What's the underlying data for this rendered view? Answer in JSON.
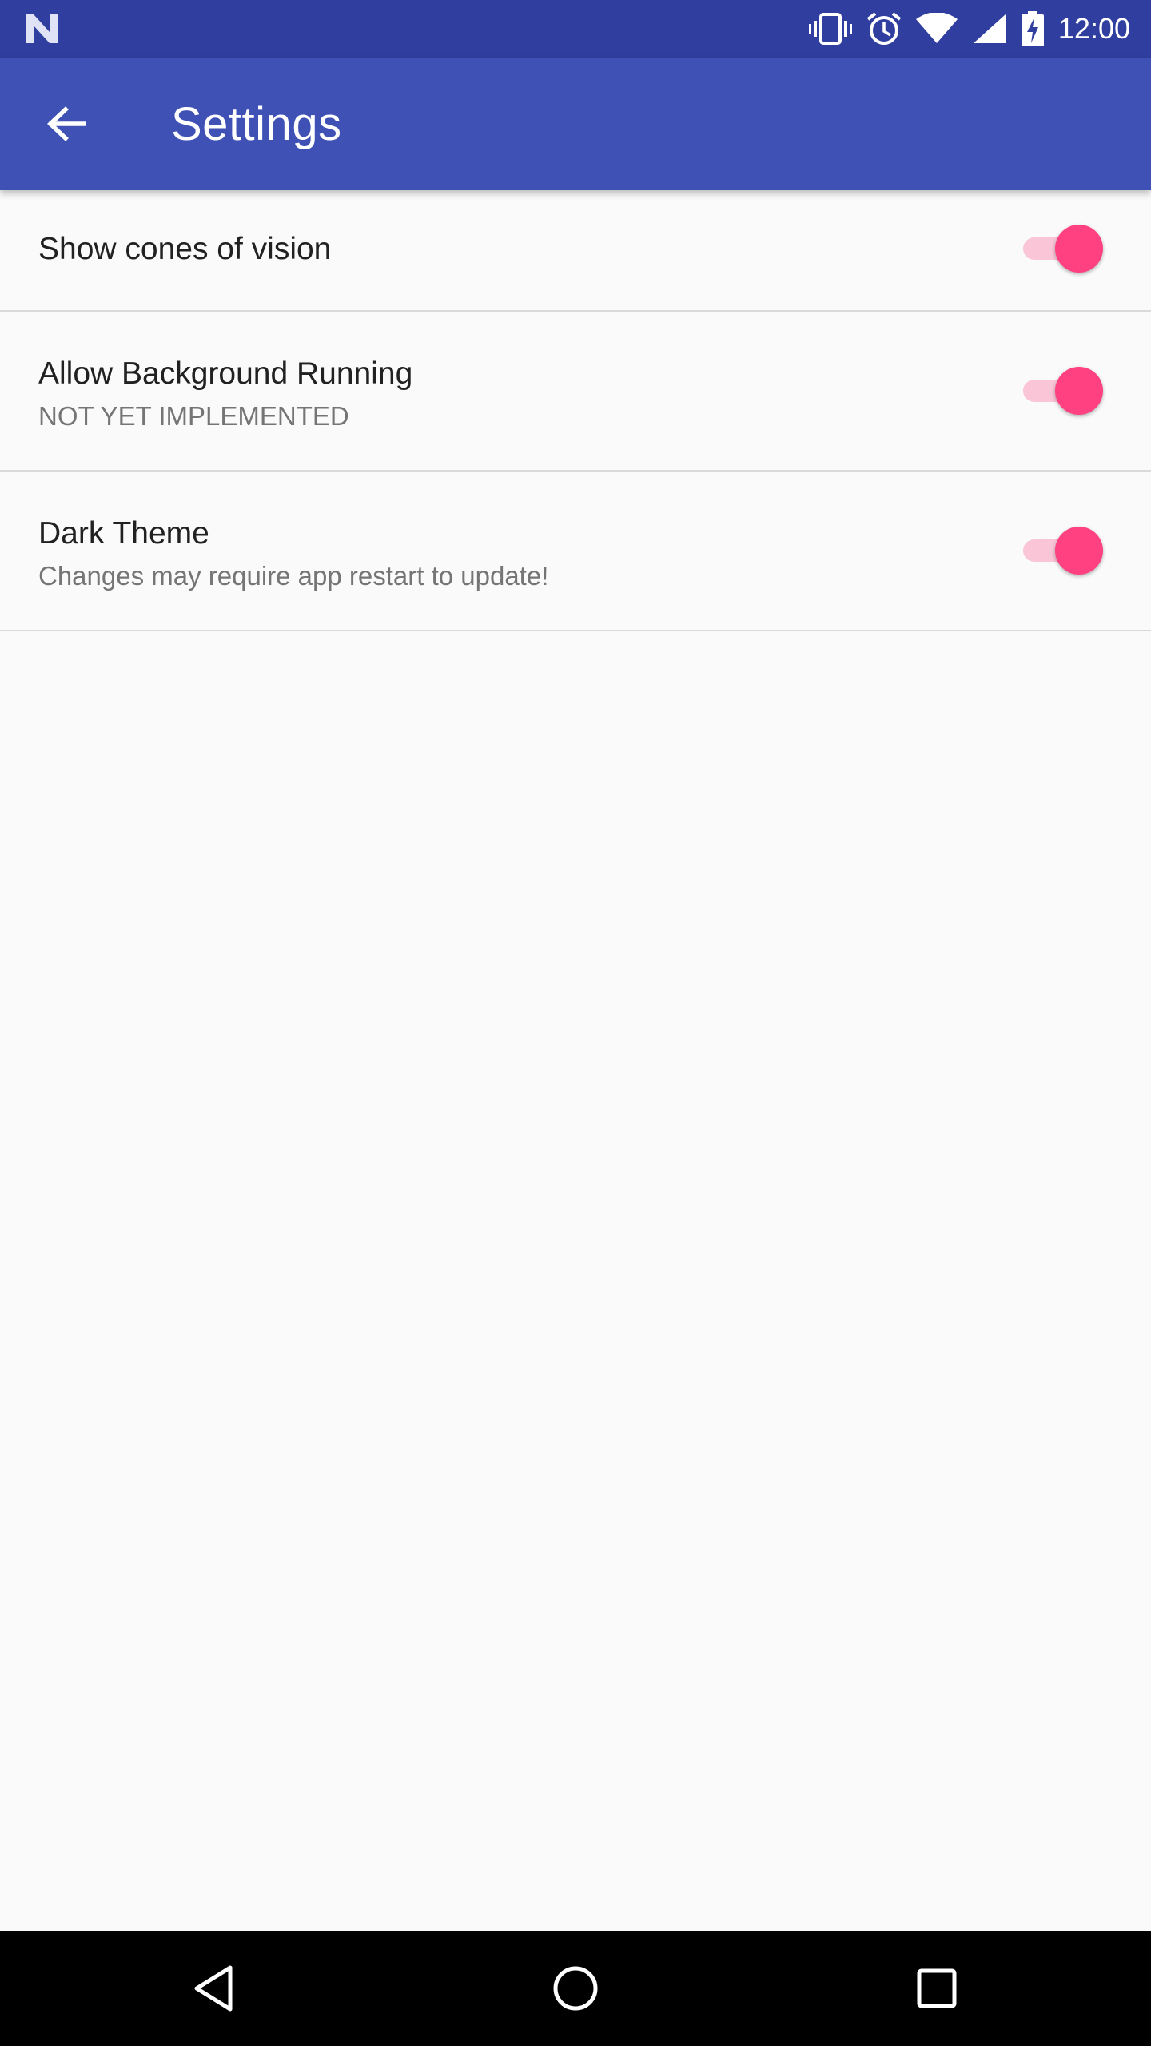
{
  "status_bar": {
    "time": "12:00",
    "icons": [
      "notification-n-icon",
      "vibrate-icon",
      "alarm-icon",
      "wifi-icon",
      "cell-signal-icon",
      "battery-charging-icon"
    ],
    "background": "#303f9f"
  },
  "app_bar": {
    "title": "Settings",
    "back_icon": "arrow-back-icon",
    "background": "#3f51b5"
  },
  "preferences": [
    {
      "title": "Show cones of vision",
      "summary": "",
      "enabled": true
    },
    {
      "title": "Allow Background Running",
      "summary": "NOT YET IMPLEMENTED",
      "enabled": true
    },
    {
      "title": "Dark Theme",
      "summary": "Changes may require app restart to update!",
      "enabled": true
    }
  ],
  "colors": {
    "accent": "#ff4081",
    "accent_track": "#f8bbd0",
    "background": "#fafafa",
    "divider": "#dadada"
  },
  "nav_bar": {
    "icons": [
      "nav-back-icon",
      "nav-home-icon",
      "nav-recents-icon"
    ]
  }
}
